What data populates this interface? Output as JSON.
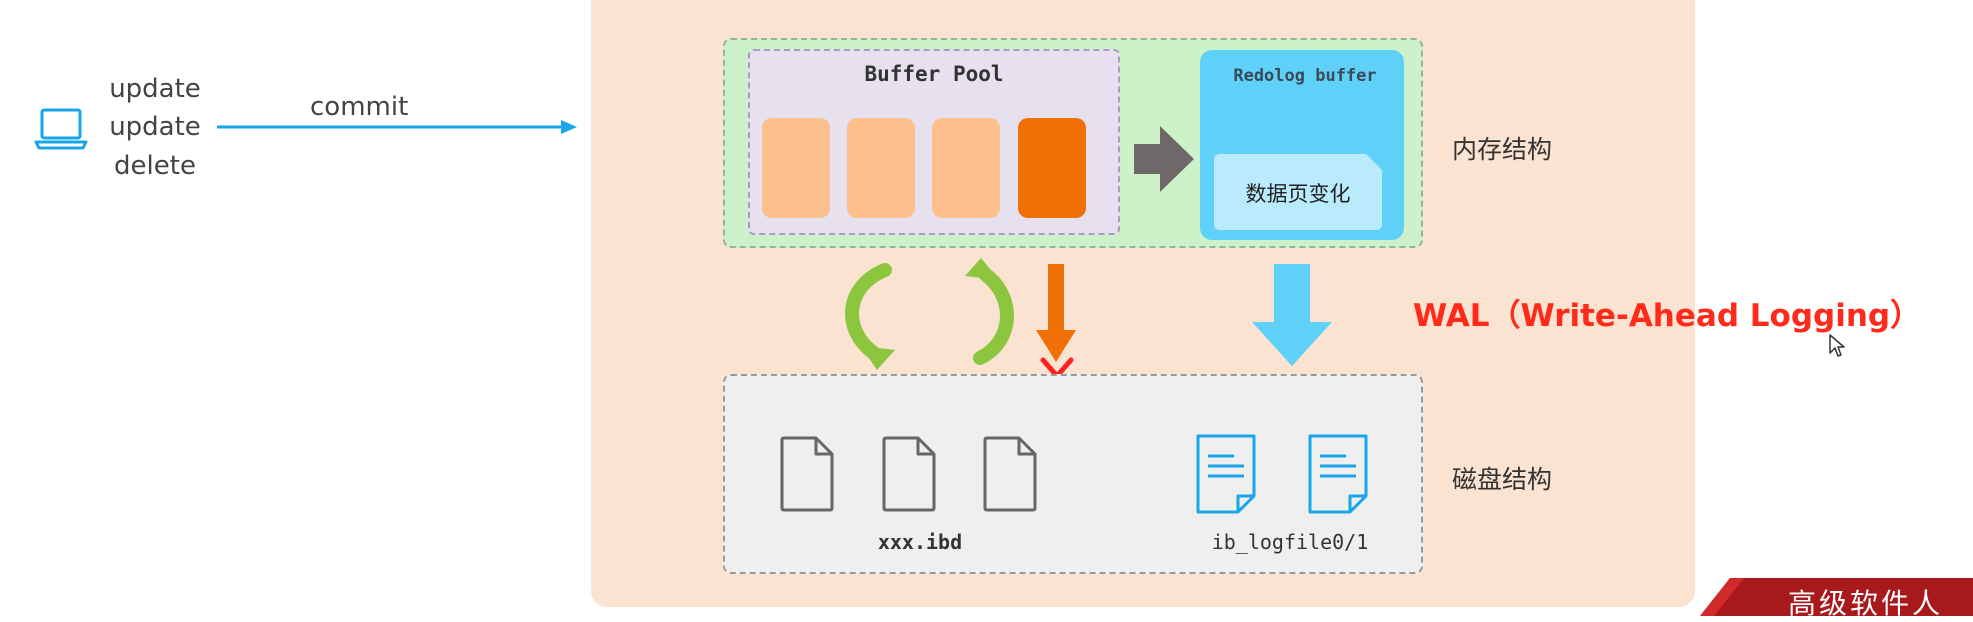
{
  "operations": [
    "update",
    "update",
    "delete"
  ],
  "commit_label": "commit",
  "buffer_pool": {
    "title": "Buffer Pool",
    "pages": [
      {
        "color": "#fdbf8c",
        "state": "clean"
      },
      {
        "color": "#fdbf8c",
        "state": "clean"
      },
      {
        "color": "#fdbf8c",
        "state": "clean"
      },
      {
        "color": "#f07007",
        "state": "dirty"
      }
    ]
  },
  "redolog_buffer": {
    "title": "Redolog buffer",
    "content": "数据页变化"
  },
  "memory_label": "内存结构",
  "disk_label": "磁盘结构",
  "wal_label": "WAL（Write-Ahead Logging）",
  "data_files": {
    "label": "xxx.ibd",
    "count": 3
  },
  "log_files": {
    "label": "ib_logfile0/1",
    "count": 2
  },
  "badge": {
    "text": "高级软件人"
  },
  "colors": {
    "accent_blue": "#1aa5e8",
    "wal_red": "#ff2a1a",
    "cycle_green": "#8cc63f",
    "dirty_orange": "#f07007",
    "flush_arrow_gray": "#6f6869",
    "redo_arrow_blue": "#5fd0f7"
  },
  "icons": {
    "client": "laptop-icon",
    "data_file": "file-icon",
    "log_file": "text-file-icon",
    "blocked": "cross-icon"
  }
}
